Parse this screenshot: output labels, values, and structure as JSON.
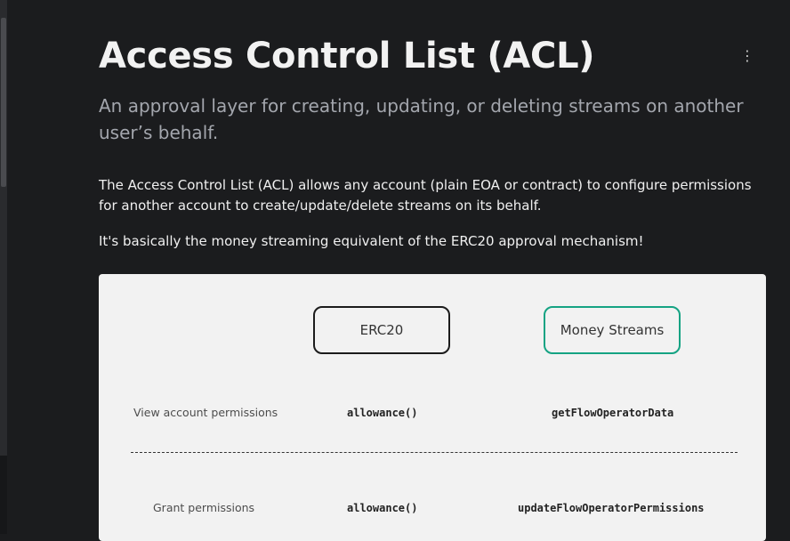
{
  "header": {
    "title": "Access Control List (ACL)",
    "subtitle": "An approval layer for creating, updating, or deleting streams on another user’s behalf.",
    "menu_icon": "⋮"
  },
  "body": {
    "paragraph_1": "The Access Control List (ACL) allows any account (plain EOA or contract) to configure permissions for another account to create/update/delete streams on its behalf.",
    "paragraph_2": "It's basically the money streaming equivalent of the ERC20 approval mechanism!"
  },
  "diagram": {
    "columns": {
      "erc20": "ERC20",
      "money_streams": "Money Streams"
    },
    "rows": [
      {
        "label": "View account permissions",
        "erc20": "allowance()",
        "money_streams": "getFlowOperatorData"
      },
      {
        "label": "Grant permissions",
        "erc20": "allowance()",
        "money_streams": "updateFlowOperatorPermissions"
      }
    ],
    "colors": {
      "erc20_border": "#1c1c1c",
      "money_streams_border": "#15a383",
      "background": "#f2f2f2"
    }
  },
  "theme": {
    "page_background": "#1b1c1e",
    "title_color": "#f2f2f2",
    "subtitle_color": "#a3a6ad"
  }
}
